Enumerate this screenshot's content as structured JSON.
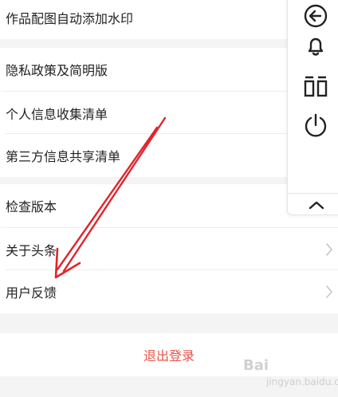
{
  "settings": {
    "group1": [
      {
        "label": "作品配图自动添加水印"
      }
    ],
    "group2": [
      {
        "label": "隐私政策及简明版"
      },
      {
        "label": "个人信息收集清单"
      },
      {
        "label": "第三方信息共享清单"
      }
    ],
    "group3": [
      {
        "label": "检查版本"
      },
      {
        "label": "关于头条"
      },
      {
        "label": "用户反馈"
      }
    ]
  },
  "logout": {
    "label": "退出登录"
  },
  "float_panel": {
    "icons": [
      "back-circle-icon",
      "bell-icon",
      "split-screen-icon",
      "power-icon",
      "chevron-up-icon"
    ]
  },
  "watermark": {
    "text": "Bai",
    "sub": "jingyan.baidu.com"
  },
  "colors": {
    "logout_text": "#e8534b",
    "annotation_arrow": "#e0252b",
    "background": "#f4f4f4"
  }
}
